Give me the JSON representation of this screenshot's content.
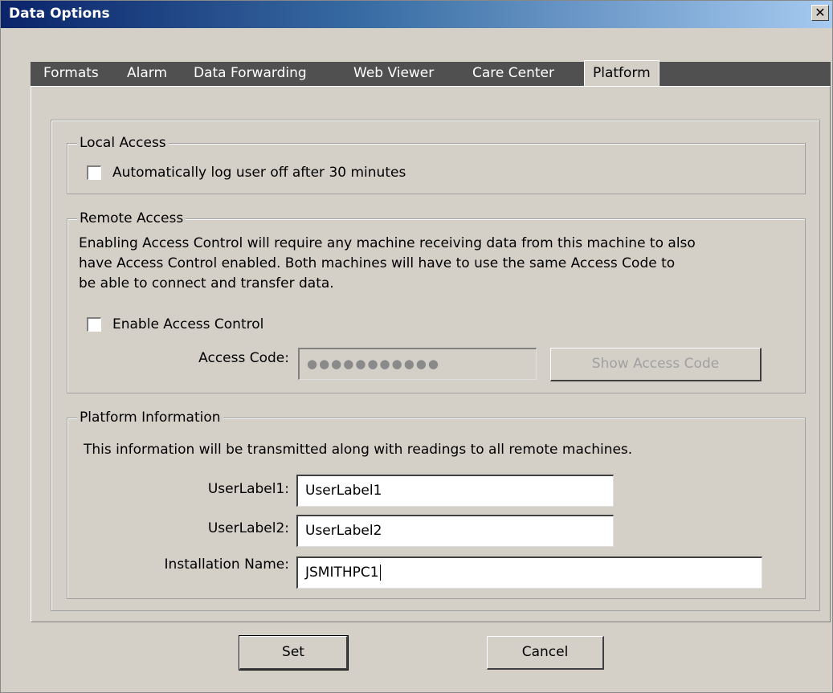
{
  "window": {
    "title": "Data Options",
    "close_glyph": "✕"
  },
  "tabs": [
    {
      "label": "Formats",
      "active": false
    },
    {
      "label": "Alarm",
      "active": false
    },
    {
      "label": "Data Forwarding",
      "active": false
    },
    {
      "label": "Web Viewer",
      "active": false
    },
    {
      "label": "Care Center",
      "active": false
    },
    {
      "label": "Platform",
      "active": true
    }
  ],
  "local_access": {
    "legend": "Local Access",
    "auto_logoff_label": "Automatically log user off after 30 minutes",
    "auto_logoff_checked": false
  },
  "remote_access": {
    "legend": "Remote Access",
    "description_lines": [
      "Enabling Access Control will require any machine receiving data from this machine to also",
      "have Access Control enabled. Both machines will have to use the same Access Code to",
      "be able to connect and transfer data."
    ],
    "enable_label": "Enable Access Control",
    "enable_checked": false,
    "access_code_label": "Access Code:",
    "access_code_value": "●●●●●●●●●●●",
    "show_button_label": "Show Access Code"
  },
  "platform_info": {
    "legend": "Platform Information",
    "description": "This information will be transmitted along with readings to all remote machines.",
    "userlabel1_label": "UserLabel1:",
    "userlabel1_value": "UserLabel1",
    "userlabel2_label": "UserLabel2:",
    "userlabel2_value": "UserLabel2",
    "installation_label": "Installation Name:",
    "installation_value": "JSMITHPC1"
  },
  "buttons": {
    "set": "Set",
    "cancel": "Cancel"
  },
  "colors": {
    "titlebar_start": "#0a246a",
    "titlebar_end": "#a6caf0",
    "dialog_bg": "#d4d0c8",
    "tabstrip_bg": "#505050"
  }
}
